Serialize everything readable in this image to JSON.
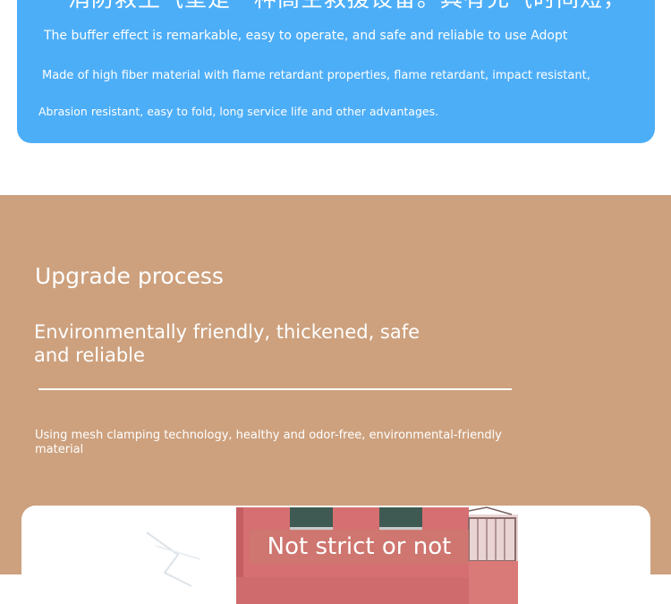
{
  "intro_card": {
    "chinese_title": "消防救生气垫是一种高空救援设备。具有充气时间短，",
    "lines": [
      "The buffer effect is remarkable, easy to operate, and safe and reliable to use Adopt",
      "Made of high fiber material with flame retardant properties, flame retardant, impact resistant,",
      "Abrasion resistant, easy to fold, long service life and other advantages."
    ]
  },
  "upgrade": {
    "title": "Upgrade process",
    "subtitle": "Environmentally friendly, thickened, safe and reliable",
    "body": "Using mesh clamping technology, healthy and odor-free, environmental-friendly material"
  },
  "image_card": {
    "caption": "Not strict or not"
  },
  "colors": {
    "blue_card": "#4daef8",
    "tan_background": "#cda17e",
    "caption_overlay": "#cc786e"
  }
}
